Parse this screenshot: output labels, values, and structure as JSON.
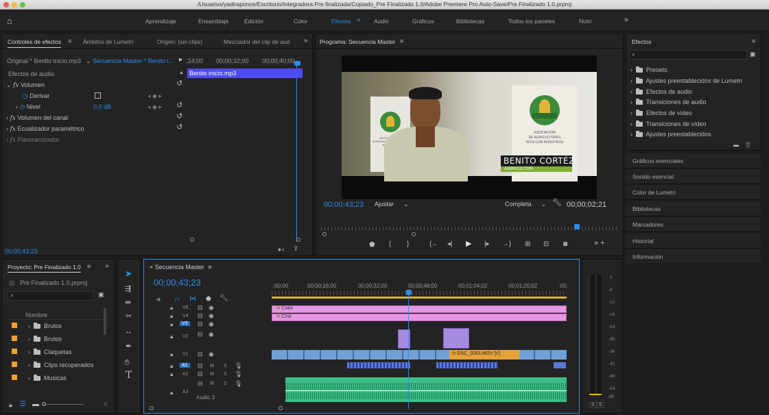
{
  "window": {
    "title": "/Usuarios/yadiraponce/Escritorio/Integradora Pre finalizada/Copiado_Pre Finalizado 1.0/Adobe Premiere Pro Auto-Save/Pre Finalizado 1.0.prproj"
  },
  "workspaces": [
    "Aprendizaje",
    "Ensamblaje",
    "Edición",
    "Color",
    "Efectos",
    "Audio",
    "Gráficos",
    "Bibliotecas",
    "Todos los paneles",
    "Nutrr"
  ],
  "workspace_active": "Efectos",
  "effect_controls": {
    "tabs": [
      "Controles de efectos",
      "Ámbitos de Lumetri",
      "Origen: (sin clips)",
      "Mezclador del clip de aud"
    ],
    "source": "Original * Benito inicio.mp3",
    "sequence": "Secuencia Master * Benito i...",
    "ruler": [
      ";24;00",
      "00;00;32;00",
      "00;00;40;00"
    ],
    "clip_name": "Benito inicio.mp3",
    "section": "Efectos de audio",
    "rows": [
      "Volumen",
      "Derivar",
      "Nivel",
      "Volumen del canal",
      "Ecualizador paramétrico",
      "Panoramizador"
    ],
    "nivel_value": "0,0 dB",
    "timecode": "00;00;43;23"
  },
  "program": {
    "title": "Programa: Secuencia Master",
    "video": {
      "banner_left": "ASOCIACIÓN DE AGRICULTORES DIOS CON NOSOTROS",
      "banner_right_1": "ASOCIACIÓN",
      "banner_right_2": "DE AGRICULTORES",
      "banner_right_3": "DIOS CON NOSOTROS",
      "name": "BENITO CORTÉZ",
      "role": "AGRICULTOR"
    },
    "timecode": "00;00;43;23",
    "fit": "Ajustar",
    "quality": "Completa",
    "duration": "00;00;02;21"
  },
  "effects_panel": {
    "title": "Efectos",
    "items": [
      "Presets",
      "Ajustes preestablecidos de Lumetri",
      "Efectos de audio",
      "Transiciones de audio",
      "Efectos de vídeo",
      "Transiciones de vídeo",
      "Ajustes preestablecidos"
    ],
    "sections": [
      "Gráficos esenciales",
      "Sonido esencial",
      "Color de Lumetri",
      "Bibliotecas",
      "Marcadores",
      "Historial",
      "Información"
    ]
  },
  "project": {
    "title": "Proyecto: Pre Finalizado 1.0",
    "file": "Pre Finalizado 1.0.prproj",
    "col_name": "Nombre",
    "items": [
      "Brutos",
      "Brutos",
      "Claquetas",
      "Clips recuperados",
      "Musicas"
    ]
  },
  "timeline": {
    "title": "Secuencia Master",
    "timecode": "00;00;43;23",
    "ruler": [
      ";00;00",
      "00;00;16;00",
      "00;00;32;00",
      "00;00;48;00",
      "00;01;04;02",
      "00;01;20;02",
      "00;"
    ],
    "tracks": [
      "V5",
      "V4",
      "V3",
      "V2",
      "V1",
      "A1",
      "A2",
      "A3"
    ],
    "audio3_label": "Audio 3",
    "clip_color": "Color",
    "clip_cine": "Cine",
    "clip_v1": "DSC_0263.MOV [V]",
    "meter_labels": [
      "0",
      "-6",
      "-12",
      "-18",
      "-24",
      "-30",
      "-36",
      "-42",
      "-48",
      "-54",
      "dB"
    ],
    "meter_buttons": [
      "S",
      "S"
    ]
  },
  "colors": {
    "accent": "#2d8ceb",
    "pink_clip": "#e597e3",
    "violet_clip": "#a78be0",
    "video_clip": "#6f9fd6",
    "audio_clip": "#3cbf87",
    "swatch": "#f0a030"
  }
}
